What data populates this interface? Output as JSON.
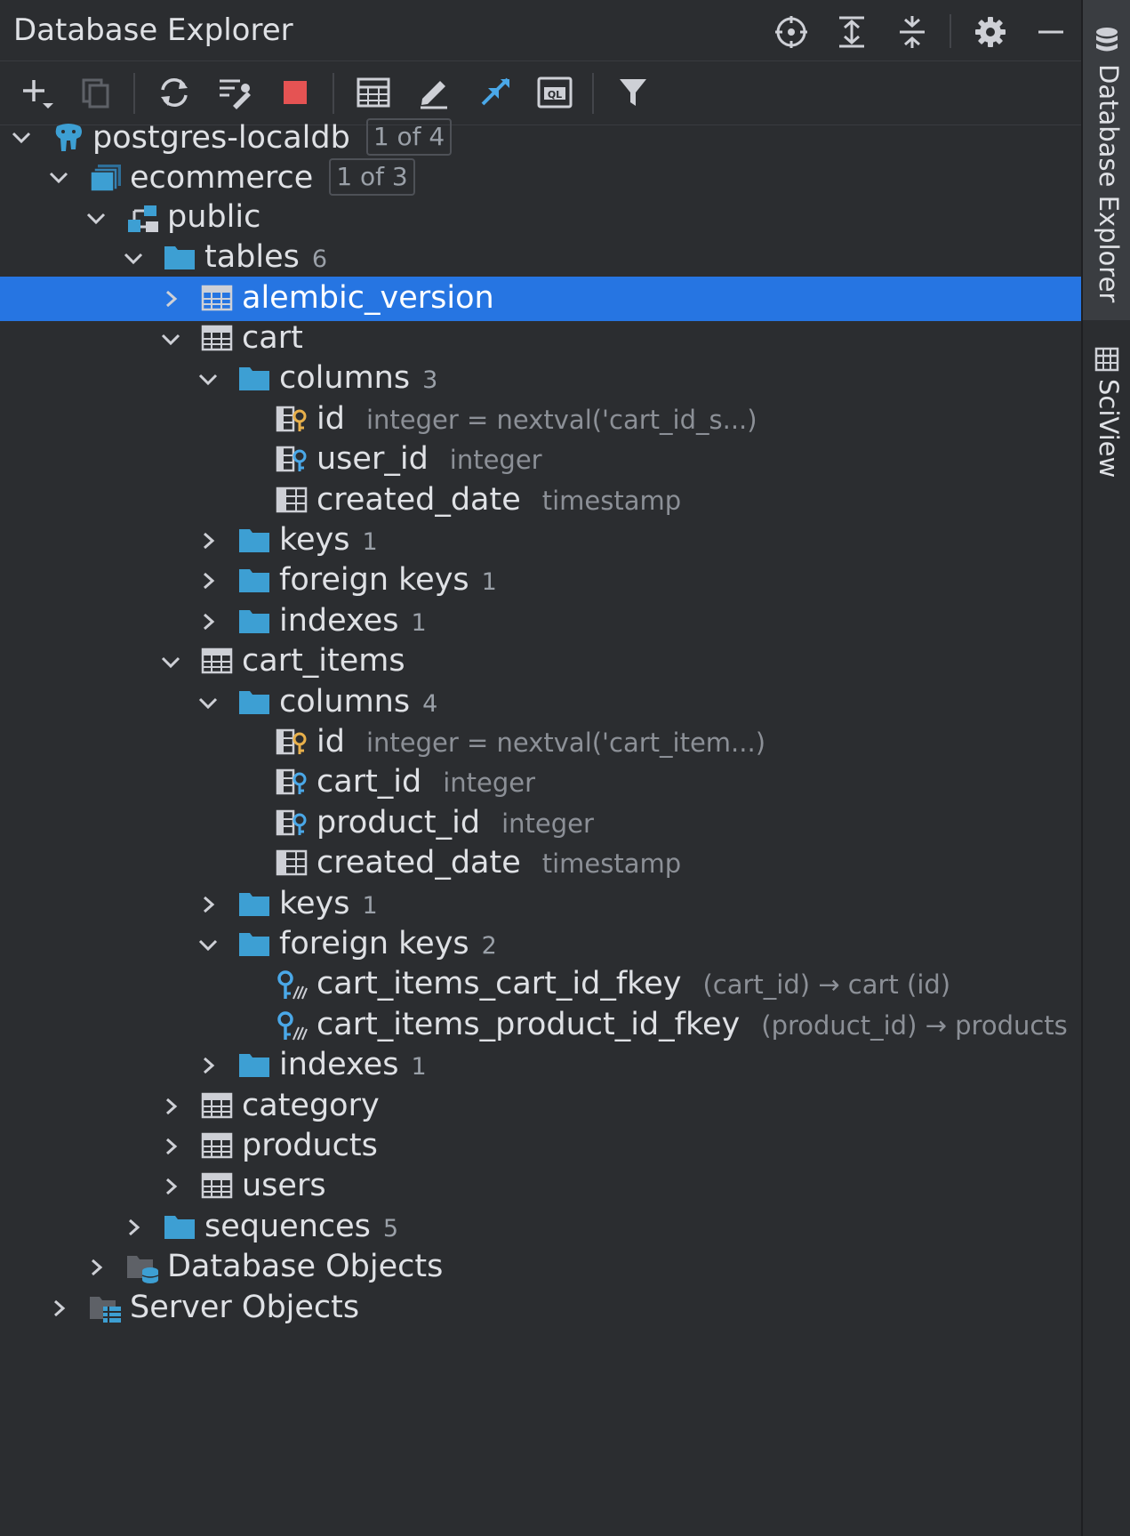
{
  "panel": {
    "title": "Database Explorer",
    "header_icons": [
      "crosshair-icon",
      "expand-all-icon",
      "collapse-all-icon",
      "gear-icon",
      "minimize-icon"
    ]
  },
  "toolbar": {
    "icons": [
      "add-icon",
      "duplicate-icon",
      "refresh-icon",
      "data-source-properties-icon",
      "stop-icon",
      "table-view-icon",
      "edit-icon",
      "jump-to-icon",
      "console-icon",
      "filter-icon"
    ]
  },
  "tree": [
    {
      "label": "postgres-localdb",
      "badge": "1 of 4",
      "icon": "postgres-elephant-icon",
      "level": 0,
      "expanded": true
    },
    {
      "label": "ecommerce",
      "badge": "1 of 3",
      "icon": "database-icon",
      "level": 1,
      "expanded": true
    },
    {
      "label": "public",
      "icon": "schema-icon",
      "level": 2,
      "expanded": true
    },
    {
      "label": "tables",
      "count": "6",
      "icon": "folder-icon",
      "level": 3,
      "expanded": true
    },
    {
      "label": "alembic_version",
      "icon": "table-icon",
      "level": 4,
      "expanded": false,
      "selected": true
    },
    {
      "label": "cart",
      "icon": "table-icon",
      "level": 4,
      "expanded": true
    },
    {
      "label": "columns",
      "count": "3",
      "icon": "folder-icon",
      "level": 5,
      "expanded": true
    },
    {
      "label": "id",
      "hint": "integer = nextval('cart_id_s...)",
      "icon": "primary-key-column-icon",
      "level": 6
    },
    {
      "label": "user_id",
      "hint": "integer",
      "icon": "foreign-key-column-icon",
      "level": 6
    },
    {
      "label": "created_date",
      "hint": "timestamp",
      "icon": "column-icon",
      "level": 6
    },
    {
      "label": "keys",
      "count": "1",
      "icon": "folder-icon",
      "level": 5,
      "expanded": false
    },
    {
      "label": "foreign keys",
      "count": "1",
      "icon": "folder-icon",
      "level": 5,
      "expanded": false
    },
    {
      "label": "indexes",
      "count": "1",
      "icon": "folder-icon",
      "level": 5,
      "expanded": false
    },
    {
      "label": "cart_items",
      "icon": "table-icon",
      "level": 4,
      "expanded": true
    },
    {
      "label": "columns",
      "count": "4",
      "icon": "folder-icon",
      "level": 5,
      "expanded": true
    },
    {
      "label": "id",
      "hint": "integer = nextval('cart_item...)",
      "icon": "primary-key-column-icon",
      "level": 6
    },
    {
      "label": "cart_id",
      "hint": "integer",
      "icon": "foreign-key-column-icon",
      "level": 6
    },
    {
      "label": "product_id",
      "hint": "integer",
      "icon": "foreign-key-column-icon",
      "level": 6
    },
    {
      "label": "created_date",
      "hint": "timestamp",
      "icon": "column-icon",
      "level": 6
    },
    {
      "label": "keys",
      "count": "1",
      "icon": "folder-icon",
      "level": 5,
      "expanded": false
    },
    {
      "label": "foreign keys",
      "count": "2",
      "icon": "folder-icon",
      "level": 5,
      "expanded": true
    },
    {
      "label": "cart_items_cart_id_fkey",
      "hint": "(cart_id) → cart (id)",
      "icon": "foreign-key-icon",
      "level": 6
    },
    {
      "label": "cart_items_product_id_fkey",
      "hint": "(product_id) → products",
      "icon": "foreign-key-icon",
      "level": 6
    },
    {
      "label": "indexes",
      "count": "1",
      "icon": "folder-icon",
      "level": 5,
      "expanded": false
    },
    {
      "label": "category",
      "icon": "table-icon",
      "level": 4,
      "expanded": false
    },
    {
      "label": "products",
      "icon": "table-icon",
      "level": 4,
      "expanded": false
    },
    {
      "label": "users",
      "icon": "table-icon",
      "level": 4,
      "expanded": false
    },
    {
      "label": "sequences",
      "count": "5",
      "icon": "folder-icon",
      "level": 3,
      "expanded": false
    },
    {
      "label": "Database Objects",
      "icon": "database-objects-icon",
      "level": 2,
      "expanded": false
    },
    {
      "label": "Server Objects",
      "icon": "server-objects-icon",
      "level": 1,
      "expanded": false
    }
  ],
  "sidebar": {
    "tabs": [
      {
        "label": "Database Explorer",
        "icon": "database-icon",
        "active": true
      },
      {
        "label": "SciView",
        "icon": "table-view-icon",
        "active": false
      }
    ]
  },
  "colors": {
    "background": "#2b2d30",
    "selection": "#2675e2",
    "folder": "#3d9fd3",
    "key": "#e8b04b",
    "stop": "#e55353"
  }
}
